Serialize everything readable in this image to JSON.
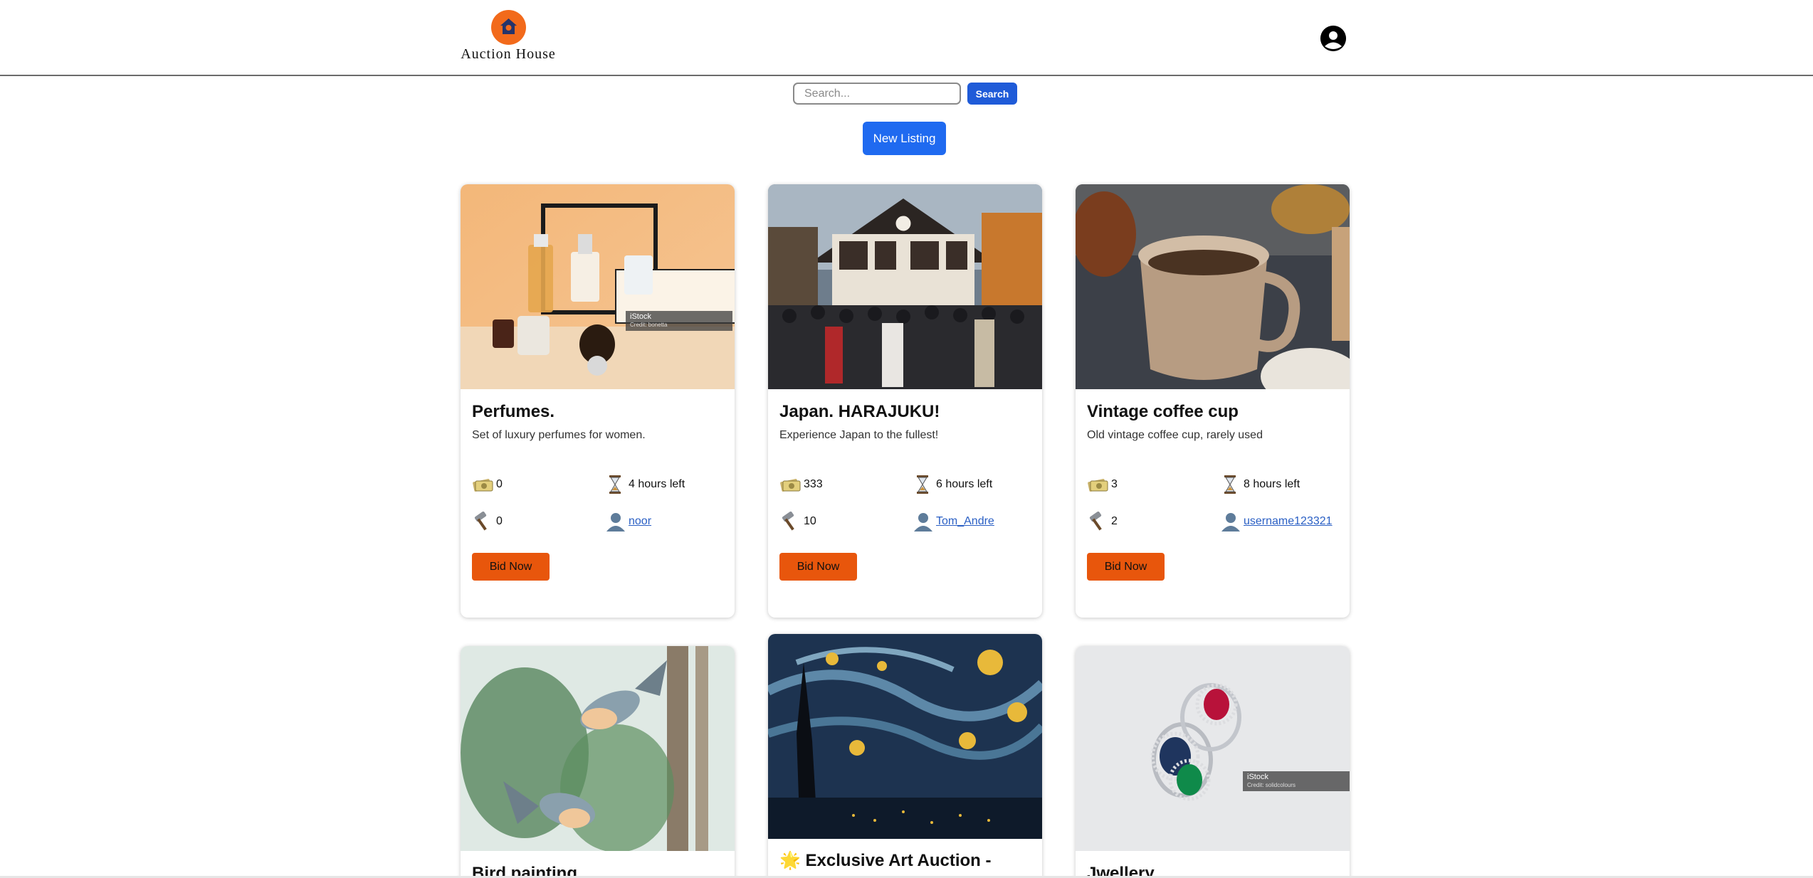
{
  "app": {
    "logo_text": "Auction House",
    "brand_color": "#f26a1b",
    "icons": {
      "logo": "house-icon",
      "account": "user-circle-icon"
    }
  },
  "search": {
    "placeholder": "Search...",
    "value": "",
    "button_label": "Search"
  },
  "actions": {
    "new_listing_label": "New Listing"
  },
  "listings": [
    {
      "title": "Perfumes.",
      "description": "Set of luxury perfumes for women.",
      "current_bid": "0",
      "time_left": "4 hours left",
      "bid_count": "0",
      "seller": "noor",
      "bid_label": "Bid Now",
      "watermark": "iStock",
      "watermark_credit": "Credit: bonetta"
    },
    {
      "title": "Japan. HARAJUKU!",
      "description": "Experience Japan to the fullest!",
      "current_bid": "333",
      "time_left": "6 hours left",
      "bid_count": "10",
      "seller": "Tom_Andre",
      "bid_label": "Bid Now"
    },
    {
      "title": "Vintage coffee cup",
      "description": "Old vintage coffee cup, rarely used",
      "current_bid": "3",
      "time_left": "8 hours left",
      "bid_count": "2",
      "seller": "username123321",
      "bid_label": "Bid Now"
    },
    {
      "title": "Bird painting"
    },
    {
      "title": "🌟 Exclusive Art Auction -"
    },
    {
      "title": "Jwellery",
      "watermark": "iStock",
      "watermark_credit": "Credit: solidcolours"
    }
  ],
  "stat_icons": {
    "bid": "money-icon",
    "time": "hourglass-icon",
    "count": "gavel-icon",
    "seller": "user-icon"
  },
  "colors": {
    "bid_button": "#e8560c",
    "search_button": "#1f5bd8",
    "new_listing_button": "#1f6af0",
    "link": "#2a5fc4"
  }
}
